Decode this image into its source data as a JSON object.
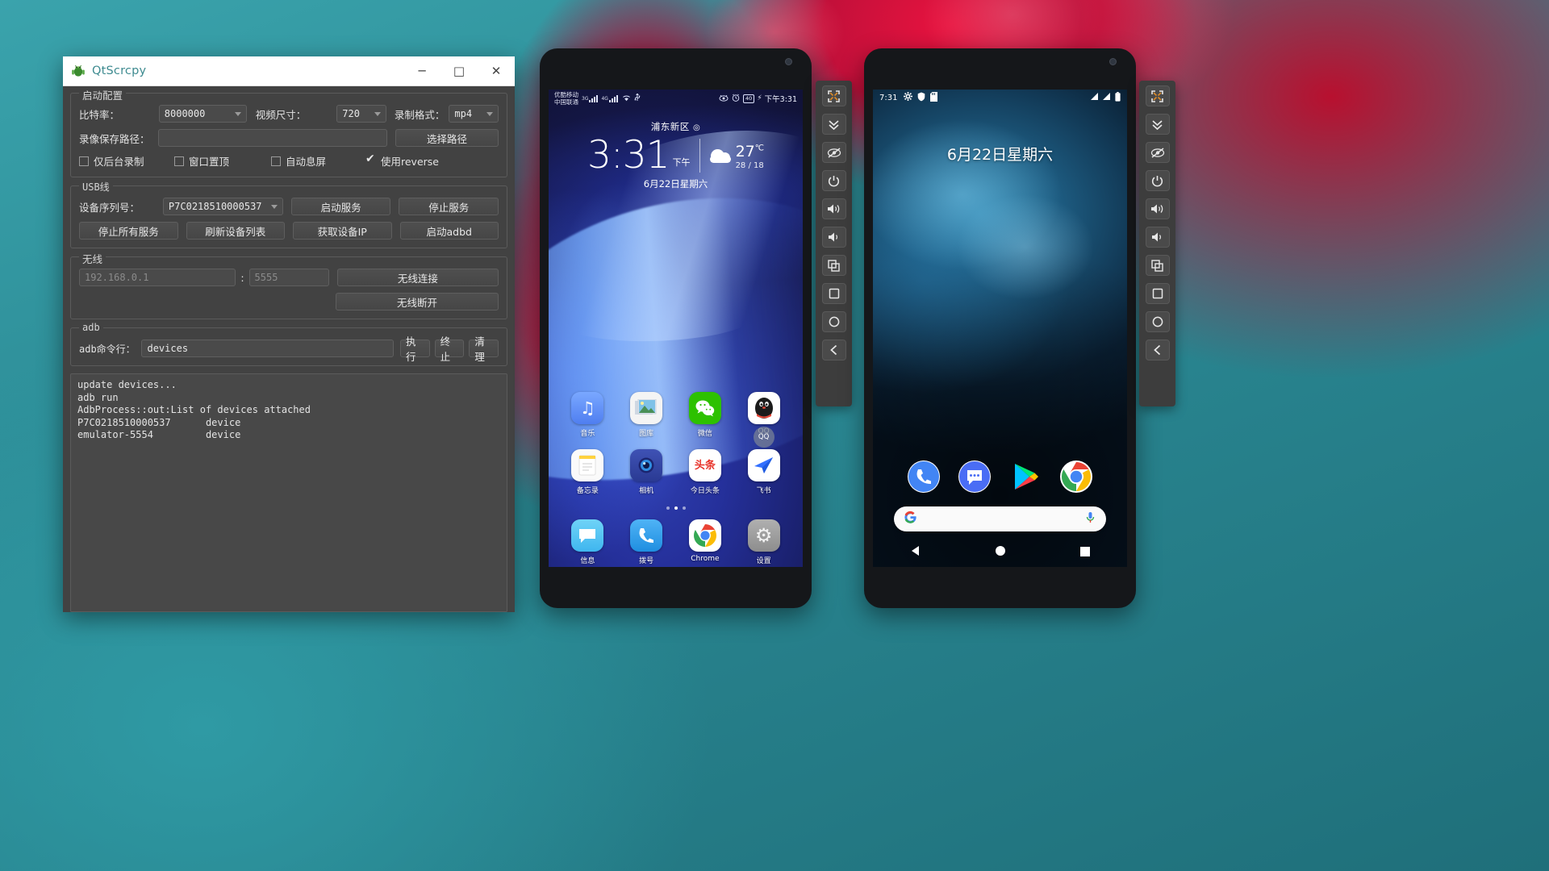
{
  "window": {
    "title": "QtScrcpy",
    "icon": "android-robot-icon",
    "minimize": "─",
    "maximize": "□",
    "close": "✕"
  },
  "start_config": {
    "legend": "启动配置",
    "bitrate_label": "比特率：",
    "bitrate_value": "8000000",
    "video_size_label": "视频尺寸：",
    "video_size_value": "720",
    "record_format_label": "录制格式：",
    "record_format_value": "mp4",
    "save_path_label": "录像保存路径：",
    "save_path_value": "",
    "choose_path_button": "选择路径",
    "checkboxes": [
      {
        "label": "仅后台录制",
        "checked": false
      },
      {
        "label": "窗口置顶",
        "checked": false
      },
      {
        "label": "自动息屏",
        "checked": false
      },
      {
        "label": "使用reverse",
        "checked": true
      }
    ]
  },
  "usb": {
    "legend": "USB线",
    "serial_label": "设备序列号：",
    "serial_value": "P7C0218510000537",
    "start_service_button": "启动服务",
    "stop_service_button": "停止服务",
    "stop_all_button": "停止所有服务",
    "refresh_devices_button": "刷新设备列表",
    "get_device_ip_button": "获取设备IP",
    "start_adbd_button": "启动adbd"
  },
  "wireless": {
    "legend": "无线",
    "ip_placeholder": "192.168.0.1",
    "ip_value": "",
    "separator": ":",
    "port_placeholder": "5555",
    "port_value": "",
    "connect_button": "无线连接",
    "disconnect_button": "无线断开"
  },
  "adb": {
    "legend": "adb",
    "command_label": "adb命令行：",
    "command_value": "devices",
    "execute_button": "执行",
    "terminate_button": "终止",
    "clear_button": "清理"
  },
  "log": {
    "text": "update devices...\nadb run\nAdbProcess::out:List of devices attached\nP7C0218510000537      device\nemulator-5554         device"
  },
  "phone1": {
    "status": {
      "carrier_line1": "优酷移动",
      "carrier_line2": "中国联通",
      "net1": "3G",
      "net2": "4G",
      "wifi_icon": "wifi-icon",
      "usb_icon": "usb-icon",
      "eye_icon": "eye-icon",
      "alarm_icon": "alarm-icon",
      "battery": "40",
      "time": "下午3:31"
    },
    "widget": {
      "location": "浦东新区",
      "time": "3:31",
      "ampm": "下午",
      "temp": "27",
      "temp_unit": "℃",
      "high_low": "28 / 18",
      "date": "6月22日星期六"
    },
    "apps_row1": [
      {
        "label": "音乐",
        "icon": "music-icon",
        "glyph": "♫",
        "bg": "#5b8ef0"
      },
      {
        "label": "图库",
        "icon": "gallery-icon",
        "glyph": "",
        "bg": "#f2f2f2"
      },
      {
        "label": "微信",
        "icon": "wechat-icon",
        "glyph": "",
        "bg": "#2dc100"
      },
      {
        "label": "QQ",
        "icon": "qq-icon",
        "glyph": "",
        "bg": "#ffffff"
      }
    ],
    "apps_row2": [
      {
        "label": "备忘录",
        "icon": "notes-icon",
        "glyph": "",
        "bg": "#f7f7f7"
      },
      {
        "label": "相机",
        "icon": "camera-icon",
        "glyph": "",
        "bg": "#3b4ea8"
      },
      {
        "label": "今日头条",
        "icon": "toutiao-icon",
        "glyph": "头条",
        "bg": "#ffffff"
      },
      {
        "label": "飞书",
        "icon": "feishu-icon",
        "glyph": "",
        "bg": "#ffffff"
      }
    ],
    "apps_row3": [
      {
        "label": "信息",
        "icon": "messages-icon",
        "glyph": "",
        "bg": "#4fc3f7"
      },
      {
        "label": "拨号",
        "icon": "phone-icon",
        "glyph": "✆",
        "bg": "#2196f3"
      },
      {
        "label": "Chrome",
        "icon": "chrome-icon",
        "glyph": "",
        "bg": "#ffffff"
      },
      {
        "label": "设置",
        "icon": "settings-icon",
        "glyph": "⚙",
        "bg": "#9e9e9e"
      }
    ],
    "page_dots": {
      "count": 3,
      "active": 1
    }
  },
  "phone2": {
    "status": {
      "time": "7:31",
      "gear_icon": "gear-icon",
      "shield_icon": "shield-icon",
      "sdcard_icon": "sdcard-icon",
      "signal_icon": "signal-icon",
      "battery_icon": "battery-icon"
    },
    "date_widget": "6月22日星期六",
    "dock": [
      {
        "label": "Phone",
        "icon": "phone-icon",
        "bg": "#4285f4"
      },
      {
        "label": "Messenger",
        "icon": "messenger-icon",
        "bg": "#4a6df5"
      },
      {
        "label": "Play Store",
        "icon": "play-store-icon",
        "bg": "#ffffff"
      },
      {
        "label": "Chrome",
        "icon": "chrome-icon",
        "bg": "#ffffff"
      }
    ],
    "search": {
      "g_icon": "google-g-icon",
      "mic_icon": "google-mic-icon",
      "value": ""
    },
    "nav": [
      {
        "name": "back-button",
        "icon": "triangle-left-icon"
      },
      {
        "name": "home-button",
        "icon": "circle-icon"
      },
      {
        "name": "recents-button",
        "icon": "square-icon"
      }
    ]
  },
  "sidebar": {
    "buttons": [
      {
        "name": "fullscreen-button",
        "icon": "expand-arrows-icon"
      },
      {
        "name": "expand-notification-button",
        "icon": "chevrons-down-icon"
      },
      {
        "name": "screen-off-button",
        "icon": "eye-slash-icon"
      },
      {
        "name": "power-button",
        "icon": "power-icon"
      },
      {
        "name": "volume-up-button",
        "icon": "volume-up-icon"
      },
      {
        "name": "volume-down-button",
        "icon": "volume-down-icon"
      },
      {
        "name": "app-switch-button",
        "icon": "copy-squares-icon"
      },
      {
        "name": "home-button",
        "icon": "square-outline-icon"
      },
      {
        "name": "menu-button",
        "icon": "circle-outline-icon"
      },
      {
        "name": "back-button",
        "icon": "chevron-left-icon"
      }
    ]
  },
  "colors": {
    "window_bg": "#424242",
    "title_text": "#3e8b90",
    "desktop_teal": "#2a8d96",
    "desktop_red": "#d81140"
  }
}
